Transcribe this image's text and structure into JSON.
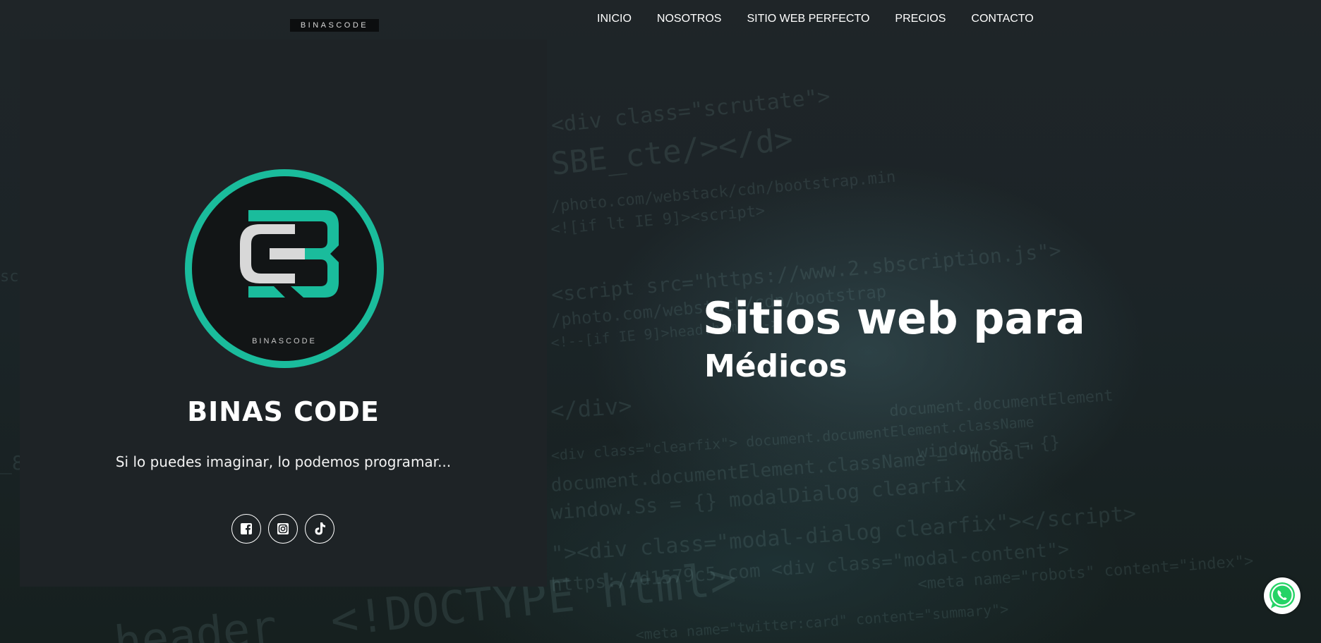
{
  "header": {
    "brand": "BINASCODE",
    "nav": [
      "INICIO",
      "NOSOTROS",
      "SITIO WEB PERFECTO",
      "PRECIOS",
      "CONTACTO"
    ]
  },
  "profile": {
    "logo_text": "BINASCODE",
    "name": "BINAS CODE",
    "tagline": "Si lo puedes imaginar, lo podemos programar...",
    "socials": [
      "facebook-icon",
      "instagram-icon",
      "tiktok-icon"
    ]
  },
  "hero": {
    "title": "Sitios web para",
    "subtitle": "Médicos"
  },
  "floating": {
    "whatsapp_icon": "whatsapp-icon"
  },
  "colors": {
    "accent": "#1abc9c",
    "background": "#1e2326",
    "whatsapp": "#25d366"
  }
}
